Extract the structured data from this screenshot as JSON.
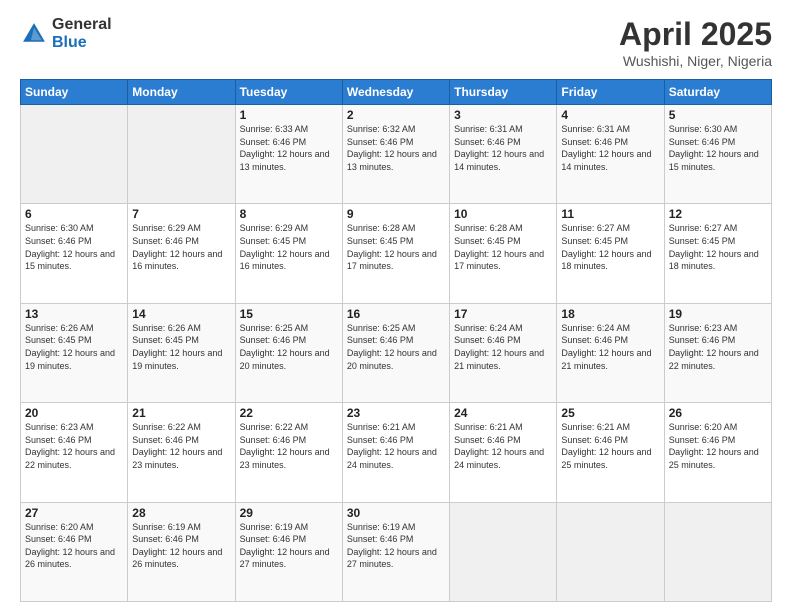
{
  "logo": {
    "general": "General",
    "blue": "Blue"
  },
  "title": "April 2025",
  "subtitle": "Wushishi, Niger, Nigeria",
  "weekdays": [
    "Sunday",
    "Monday",
    "Tuesday",
    "Wednesday",
    "Thursday",
    "Friday",
    "Saturday"
  ],
  "weeks": [
    [
      {
        "day": "",
        "sunrise": "",
        "sunset": "",
        "daylight": ""
      },
      {
        "day": "",
        "sunrise": "",
        "sunset": "",
        "daylight": ""
      },
      {
        "day": "1",
        "sunrise": "Sunrise: 6:33 AM",
        "sunset": "Sunset: 6:46 PM",
        "daylight": "Daylight: 12 hours and 13 minutes."
      },
      {
        "day": "2",
        "sunrise": "Sunrise: 6:32 AM",
        "sunset": "Sunset: 6:46 PM",
        "daylight": "Daylight: 12 hours and 13 minutes."
      },
      {
        "day": "3",
        "sunrise": "Sunrise: 6:31 AM",
        "sunset": "Sunset: 6:46 PM",
        "daylight": "Daylight: 12 hours and 14 minutes."
      },
      {
        "day": "4",
        "sunrise": "Sunrise: 6:31 AM",
        "sunset": "Sunset: 6:46 PM",
        "daylight": "Daylight: 12 hours and 14 minutes."
      },
      {
        "day": "5",
        "sunrise": "Sunrise: 6:30 AM",
        "sunset": "Sunset: 6:46 PM",
        "daylight": "Daylight: 12 hours and 15 minutes."
      }
    ],
    [
      {
        "day": "6",
        "sunrise": "Sunrise: 6:30 AM",
        "sunset": "Sunset: 6:46 PM",
        "daylight": "Daylight: 12 hours and 15 minutes."
      },
      {
        "day": "7",
        "sunrise": "Sunrise: 6:29 AM",
        "sunset": "Sunset: 6:46 PM",
        "daylight": "Daylight: 12 hours and 16 minutes."
      },
      {
        "day": "8",
        "sunrise": "Sunrise: 6:29 AM",
        "sunset": "Sunset: 6:45 PM",
        "daylight": "Daylight: 12 hours and 16 minutes."
      },
      {
        "day": "9",
        "sunrise": "Sunrise: 6:28 AM",
        "sunset": "Sunset: 6:45 PM",
        "daylight": "Daylight: 12 hours and 17 minutes."
      },
      {
        "day": "10",
        "sunrise": "Sunrise: 6:28 AM",
        "sunset": "Sunset: 6:45 PM",
        "daylight": "Daylight: 12 hours and 17 minutes."
      },
      {
        "day": "11",
        "sunrise": "Sunrise: 6:27 AM",
        "sunset": "Sunset: 6:45 PM",
        "daylight": "Daylight: 12 hours and 18 minutes."
      },
      {
        "day": "12",
        "sunrise": "Sunrise: 6:27 AM",
        "sunset": "Sunset: 6:45 PM",
        "daylight": "Daylight: 12 hours and 18 minutes."
      }
    ],
    [
      {
        "day": "13",
        "sunrise": "Sunrise: 6:26 AM",
        "sunset": "Sunset: 6:45 PM",
        "daylight": "Daylight: 12 hours and 19 minutes."
      },
      {
        "day": "14",
        "sunrise": "Sunrise: 6:26 AM",
        "sunset": "Sunset: 6:45 PM",
        "daylight": "Daylight: 12 hours and 19 minutes."
      },
      {
        "day": "15",
        "sunrise": "Sunrise: 6:25 AM",
        "sunset": "Sunset: 6:46 PM",
        "daylight": "Daylight: 12 hours and 20 minutes."
      },
      {
        "day": "16",
        "sunrise": "Sunrise: 6:25 AM",
        "sunset": "Sunset: 6:46 PM",
        "daylight": "Daylight: 12 hours and 20 minutes."
      },
      {
        "day": "17",
        "sunrise": "Sunrise: 6:24 AM",
        "sunset": "Sunset: 6:46 PM",
        "daylight": "Daylight: 12 hours and 21 minutes."
      },
      {
        "day": "18",
        "sunrise": "Sunrise: 6:24 AM",
        "sunset": "Sunset: 6:46 PM",
        "daylight": "Daylight: 12 hours and 21 minutes."
      },
      {
        "day": "19",
        "sunrise": "Sunrise: 6:23 AM",
        "sunset": "Sunset: 6:46 PM",
        "daylight": "Daylight: 12 hours and 22 minutes."
      }
    ],
    [
      {
        "day": "20",
        "sunrise": "Sunrise: 6:23 AM",
        "sunset": "Sunset: 6:46 PM",
        "daylight": "Daylight: 12 hours and 22 minutes."
      },
      {
        "day": "21",
        "sunrise": "Sunrise: 6:22 AM",
        "sunset": "Sunset: 6:46 PM",
        "daylight": "Daylight: 12 hours and 23 minutes."
      },
      {
        "day": "22",
        "sunrise": "Sunrise: 6:22 AM",
        "sunset": "Sunset: 6:46 PM",
        "daylight": "Daylight: 12 hours and 23 minutes."
      },
      {
        "day": "23",
        "sunrise": "Sunrise: 6:21 AM",
        "sunset": "Sunset: 6:46 PM",
        "daylight": "Daylight: 12 hours and 24 minutes."
      },
      {
        "day": "24",
        "sunrise": "Sunrise: 6:21 AM",
        "sunset": "Sunset: 6:46 PM",
        "daylight": "Daylight: 12 hours and 24 minutes."
      },
      {
        "day": "25",
        "sunrise": "Sunrise: 6:21 AM",
        "sunset": "Sunset: 6:46 PM",
        "daylight": "Daylight: 12 hours and 25 minutes."
      },
      {
        "day": "26",
        "sunrise": "Sunrise: 6:20 AM",
        "sunset": "Sunset: 6:46 PM",
        "daylight": "Daylight: 12 hours and 25 minutes."
      }
    ],
    [
      {
        "day": "27",
        "sunrise": "Sunrise: 6:20 AM",
        "sunset": "Sunset: 6:46 PM",
        "daylight": "Daylight: 12 hours and 26 minutes."
      },
      {
        "day": "28",
        "sunrise": "Sunrise: 6:19 AM",
        "sunset": "Sunset: 6:46 PM",
        "daylight": "Daylight: 12 hours and 26 minutes."
      },
      {
        "day": "29",
        "sunrise": "Sunrise: 6:19 AM",
        "sunset": "Sunset: 6:46 PM",
        "daylight": "Daylight: 12 hours and 27 minutes."
      },
      {
        "day": "30",
        "sunrise": "Sunrise: 6:19 AM",
        "sunset": "Sunset: 6:46 PM",
        "daylight": "Daylight: 12 hours and 27 minutes."
      },
      {
        "day": "",
        "sunrise": "",
        "sunset": "",
        "daylight": ""
      },
      {
        "day": "",
        "sunrise": "",
        "sunset": "",
        "daylight": ""
      },
      {
        "day": "",
        "sunrise": "",
        "sunset": "",
        "daylight": ""
      }
    ]
  ]
}
